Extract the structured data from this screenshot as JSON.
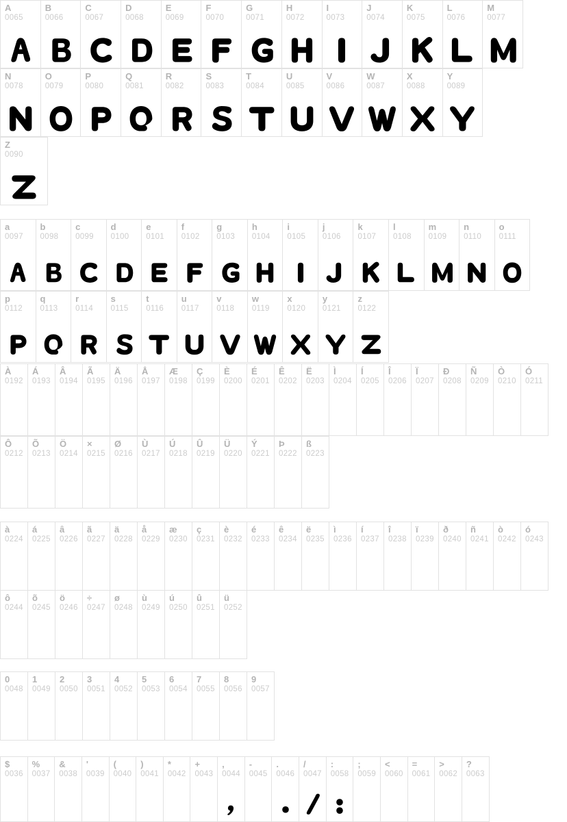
{
  "meta": {
    "title": "Font Character Map",
    "label_color": "#b4b4b4",
    "code_color": "#cccccc",
    "border_color": "#e2e2e2",
    "glyph_color": "#000000",
    "background": "#ffffff"
  },
  "blocks": [
    {
      "id": "uppercase-row-1",
      "name": "uppercase-letters-a-m",
      "cells": [
        {
          "char": "A",
          "code": "0065",
          "glyph": "A"
        },
        {
          "char": "B",
          "code": "0066",
          "glyph": "B"
        },
        {
          "char": "C",
          "code": "0067",
          "glyph": "C"
        },
        {
          "char": "D",
          "code": "0068",
          "glyph": "D"
        },
        {
          "char": "E",
          "code": "0069",
          "glyph": "E"
        },
        {
          "char": "F",
          "code": "0070",
          "glyph": "F"
        },
        {
          "char": "G",
          "code": "0071",
          "glyph": "G"
        },
        {
          "char": "H",
          "code": "0072",
          "glyph": "H"
        },
        {
          "char": "I",
          "code": "0073",
          "glyph": "I"
        },
        {
          "char": "J",
          "code": "0074",
          "glyph": "J"
        },
        {
          "char": "K",
          "code": "0075",
          "glyph": "K"
        },
        {
          "char": "L",
          "code": "0076",
          "glyph": "L"
        },
        {
          "char": "M",
          "code": "0077",
          "glyph": "M"
        }
      ]
    },
    {
      "id": "uppercase-row-2",
      "name": "uppercase-letters-n-y",
      "cells": [
        {
          "char": "N",
          "code": "0078",
          "glyph": "N"
        },
        {
          "char": "O",
          "code": "0079",
          "glyph": "O"
        },
        {
          "char": "P",
          "code": "0080",
          "glyph": "P"
        },
        {
          "char": "Q",
          "code": "0081",
          "glyph": "Q"
        },
        {
          "char": "R",
          "code": "0082",
          "glyph": "R"
        },
        {
          "char": "S",
          "code": "0083",
          "glyph": "S"
        },
        {
          "char": "T",
          "code": "0084",
          "glyph": "T"
        },
        {
          "char": "U",
          "code": "0085",
          "glyph": "U"
        },
        {
          "char": "V",
          "code": "0086",
          "glyph": "V"
        },
        {
          "char": "W",
          "code": "0087",
          "glyph": "W"
        },
        {
          "char": "X",
          "code": "0088",
          "glyph": "X"
        },
        {
          "char": "Y",
          "code": "0089",
          "glyph": "Y"
        }
      ]
    },
    {
      "id": "uppercase-row-3",
      "name": "uppercase-letter-z",
      "cells": [
        {
          "char": "Z",
          "code": "0090",
          "glyph": "Z"
        }
      ]
    },
    {
      "id": "lowercase-row-1",
      "name": "lowercase-letters-a-o",
      "cells": [
        {
          "char": "a",
          "code": "0097",
          "glyph": "A"
        },
        {
          "char": "b",
          "code": "0098",
          "glyph": "B"
        },
        {
          "char": "c",
          "code": "0099",
          "glyph": "C"
        },
        {
          "char": "d",
          "code": "0100",
          "glyph": "D"
        },
        {
          "char": "e",
          "code": "0101",
          "glyph": "E"
        },
        {
          "char": "f",
          "code": "0102",
          "glyph": "F"
        },
        {
          "char": "g",
          "code": "0103",
          "glyph": "G"
        },
        {
          "char": "h",
          "code": "0104",
          "glyph": "H"
        },
        {
          "char": "i",
          "code": "0105",
          "glyph": "I"
        },
        {
          "char": "j",
          "code": "0106",
          "glyph": "J"
        },
        {
          "char": "k",
          "code": "0107",
          "glyph": "K"
        },
        {
          "char": "l",
          "code": "0108",
          "glyph": "L"
        },
        {
          "char": "m",
          "code": "0109",
          "glyph": "M"
        },
        {
          "char": "n",
          "code": "0110",
          "glyph": "N"
        },
        {
          "char": "o",
          "code": "0111",
          "glyph": "O"
        }
      ]
    },
    {
      "id": "lowercase-row-2",
      "name": "lowercase-letters-p-z",
      "cells": [
        {
          "char": "p",
          "code": "0112",
          "glyph": "P"
        },
        {
          "char": "q",
          "code": "0113",
          "glyph": "Q"
        },
        {
          "char": "r",
          "code": "0114",
          "glyph": "R"
        },
        {
          "char": "s",
          "code": "0115",
          "glyph": "S"
        },
        {
          "char": "t",
          "code": "0116",
          "glyph": "T"
        },
        {
          "char": "u",
          "code": "0117",
          "glyph": "U"
        },
        {
          "char": "v",
          "code": "0118",
          "glyph": "V"
        },
        {
          "char": "w",
          "code": "0119",
          "glyph": "W"
        },
        {
          "char": "x",
          "code": "0120",
          "glyph": "X"
        },
        {
          "char": "y",
          "code": "0121",
          "glyph": "Y"
        },
        {
          "char": "z",
          "code": "0122",
          "glyph": "Z"
        }
      ]
    },
    {
      "id": "accented-uppercase-row-1",
      "name": "accented-uppercase-192-211",
      "cells": [
        {
          "char": "À",
          "code": "0192",
          "glyph": ""
        },
        {
          "char": "Á",
          "code": "0193",
          "glyph": ""
        },
        {
          "char": "Â",
          "code": "0194",
          "glyph": ""
        },
        {
          "char": "Ã",
          "code": "0195",
          "glyph": ""
        },
        {
          "char": "Ä",
          "code": "0196",
          "glyph": ""
        },
        {
          "char": "Å",
          "code": "0197",
          "glyph": ""
        },
        {
          "char": "Æ",
          "code": "0198",
          "glyph": ""
        },
        {
          "char": "Ç",
          "code": "0199",
          "glyph": ""
        },
        {
          "char": "È",
          "code": "0200",
          "glyph": ""
        },
        {
          "char": "É",
          "code": "0201",
          "glyph": ""
        },
        {
          "char": "Ê",
          "code": "0202",
          "glyph": ""
        },
        {
          "char": "Ë",
          "code": "0203",
          "glyph": ""
        },
        {
          "char": "Ì",
          "code": "0204",
          "glyph": ""
        },
        {
          "char": "Í",
          "code": "0205",
          "glyph": ""
        },
        {
          "char": "Î",
          "code": "0206",
          "glyph": ""
        },
        {
          "char": "Ï",
          "code": "0207",
          "glyph": ""
        },
        {
          "char": "Ð",
          "code": "0208",
          "glyph": ""
        },
        {
          "char": "Ñ",
          "code": "0209",
          "glyph": ""
        },
        {
          "char": "Ò",
          "code": "0210",
          "glyph": ""
        },
        {
          "char": "Ó",
          "code": "0211",
          "glyph": ""
        }
      ]
    },
    {
      "id": "accented-uppercase-row-2",
      "name": "accented-uppercase-212-223",
      "cells": [
        {
          "char": "Ô",
          "code": "0212",
          "glyph": ""
        },
        {
          "char": "Õ",
          "code": "0213",
          "glyph": ""
        },
        {
          "char": "Ö",
          "code": "0214",
          "glyph": ""
        },
        {
          "char": "×",
          "code": "0215",
          "glyph": ""
        },
        {
          "char": "Ø",
          "code": "0216",
          "glyph": ""
        },
        {
          "char": "Ù",
          "code": "0217",
          "glyph": ""
        },
        {
          "char": "Ú",
          "code": "0218",
          "glyph": ""
        },
        {
          "char": "Û",
          "code": "0219",
          "glyph": ""
        },
        {
          "char": "Ü",
          "code": "0220",
          "glyph": ""
        },
        {
          "char": "Ý",
          "code": "0221",
          "glyph": ""
        },
        {
          "char": "Þ",
          "code": "0222",
          "glyph": ""
        },
        {
          "char": "ß",
          "code": "0223",
          "glyph": ""
        }
      ]
    },
    {
      "id": "accented-lowercase-row-1",
      "name": "accented-lowercase-224-243",
      "cells": [
        {
          "char": "à",
          "code": "0224",
          "glyph": ""
        },
        {
          "char": "á",
          "code": "0225",
          "glyph": ""
        },
        {
          "char": "â",
          "code": "0226",
          "glyph": ""
        },
        {
          "char": "ã",
          "code": "0227",
          "glyph": ""
        },
        {
          "char": "ä",
          "code": "0228",
          "glyph": ""
        },
        {
          "char": "å",
          "code": "0229",
          "glyph": ""
        },
        {
          "char": "æ",
          "code": "0230",
          "glyph": ""
        },
        {
          "char": "ç",
          "code": "0231",
          "glyph": ""
        },
        {
          "char": "è",
          "code": "0232",
          "glyph": ""
        },
        {
          "char": "é",
          "code": "0233",
          "glyph": ""
        },
        {
          "char": "ê",
          "code": "0234",
          "glyph": ""
        },
        {
          "char": "ë",
          "code": "0235",
          "glyph": ""
        },
        {
          "char": "ì",
          "code": "0236",
          "glyph": ""
        },
        {
          "char": "í",
          "code": "0237",
          "glyph": ""
        },
        {
          "char": "î",
          "code": "0238",
          "glyph": ""
        },
        {
          "char": "ï",
          "code": "0239",
          "glyph": ""
        },
        {
          "char": "ð",
          "code": "0240",
          "glyph": ""
        },
        {
          "char": "ñ",
          "code": "0241",
          "glyph": ""
        },
        {
          "char": "ò",
          "code": "0242",
          "glyph": ""
        },
        {
          "char": "ó",
          "code": "0243",
          "glyph": ""
        }
      ]
    },
    {
      "id": "accented-lowercase-row-2",
      "name": "accented-lowercase-244-252",
      "cells": [
        {
          "char": "ô",
          "code": "0244",
          "glyph": ""
        },
        {
          "char": "õ",
          "code": "0245",
          "glyph": ""
        },
        {
          "char": "ö",
          "code": "0246",
          "glyph": ""
        },
        {
          "char": "÷",
          "code": "0247",
          "glyph": ""
        },
        {
          "char": "ø",
          "code": "0248",
          "glyph": ""
        },
        {
          "char": "ù",
          "code": "0249",
          "glyph": ""
        },
        {
          "char": "ú",
          "code": "0250",
          "glyph": ""
        },
        {
          "char": "û",
          "code": "0251",
          "glyph": ""
        },
        {
          "char": "ü",
          "code": "0252",
          "glyph": ""
        }
      ]
    },
    {
      "id": "digits-row",
      "name": "digits-0-9",
      "cells": [
        {
          "char": "0",
          "code": "0048",
          "glyph": ""
        },
        {
          "char": "1",
          "code": "0049",
          "glyph": ""
        },
        {
          "char": "2",
          "code": "0050",
          "glyph": ""
        },
        {
          "char": "3",
          "code": "0051",
          "glyph": ""
        },
        {
          "char": "4",
          "code": "0052",
          "glyph": ""
        },
        {
          "char": "5",
          "code": "0053",
          "glyph": ""
        },
        {
          "char": "6",
          "code": "0054",
          "glyph": ""
        },
        {
          "char": "7",
          "code": "0055",
          "glyph": ""
        },
        {
          "char": "8",
          "code": "0056",
          "glyph": ""
        },
        {
          "char": "9",
          "code": "0057",
          "glyph": ""
        }
      ]
    },
    {
      "id": "punctuation-row",
      "name": "punctuation-symbols",
      "cells": [
        {
          "char": "$",
          "code": "0036",
          "glyph": ""
        },
        {
          "char": "%",
          "code": "0037",
          "glyph": ""
        },
        {
          "char": "&",
          "code": "0038",
          "glyph": ""
        },
        {
          "char": "'",
          "code": "0039",
          "glyph": ""
        },
        {
          "char": "(",
          "code": "0040",
          "glyph": ""
        },
        {
          "char": ")",
          "code": "0041",
          "glyph": ""
        },
        {
          "char": "*",
          "code": "0042",
          "glyph": ""
        },
        {
          "char": "+",
          "code": "0043",
          "glyph": ""
        },
        {
          "char": ",",
          "code": "0044",
          "glyph": "COMMA"
        },
        {
          "char": "-",
          "code": "0045",
          "glyph": ""
        },
        {
          "char": ".",
          "code": "0046",
          "glyph": "PERIOD"
        },
        {
          "char": "/",
          "code": "0047",
          "glyph": "SLASH"
        },
        {
          "char": ":",
          "code": "0058",
          "glyph": "COLON"
        },
        {
          "char": ";",
          "code": "0059",
          "glyph": ""
        },
        {
          "char": "<",
          "code": "0060",
          "glyph": ""
        },
        {
          "char": "=",
          "code": "0061",
          "glyph": ""
        },
        {
          "char": ">",
          "code": "0062",
          "glyph": ""
        },
        {
          "char": "?",
          "code": "0063",
          "glyph": ""
        }
      ]
    }
  ]
}
